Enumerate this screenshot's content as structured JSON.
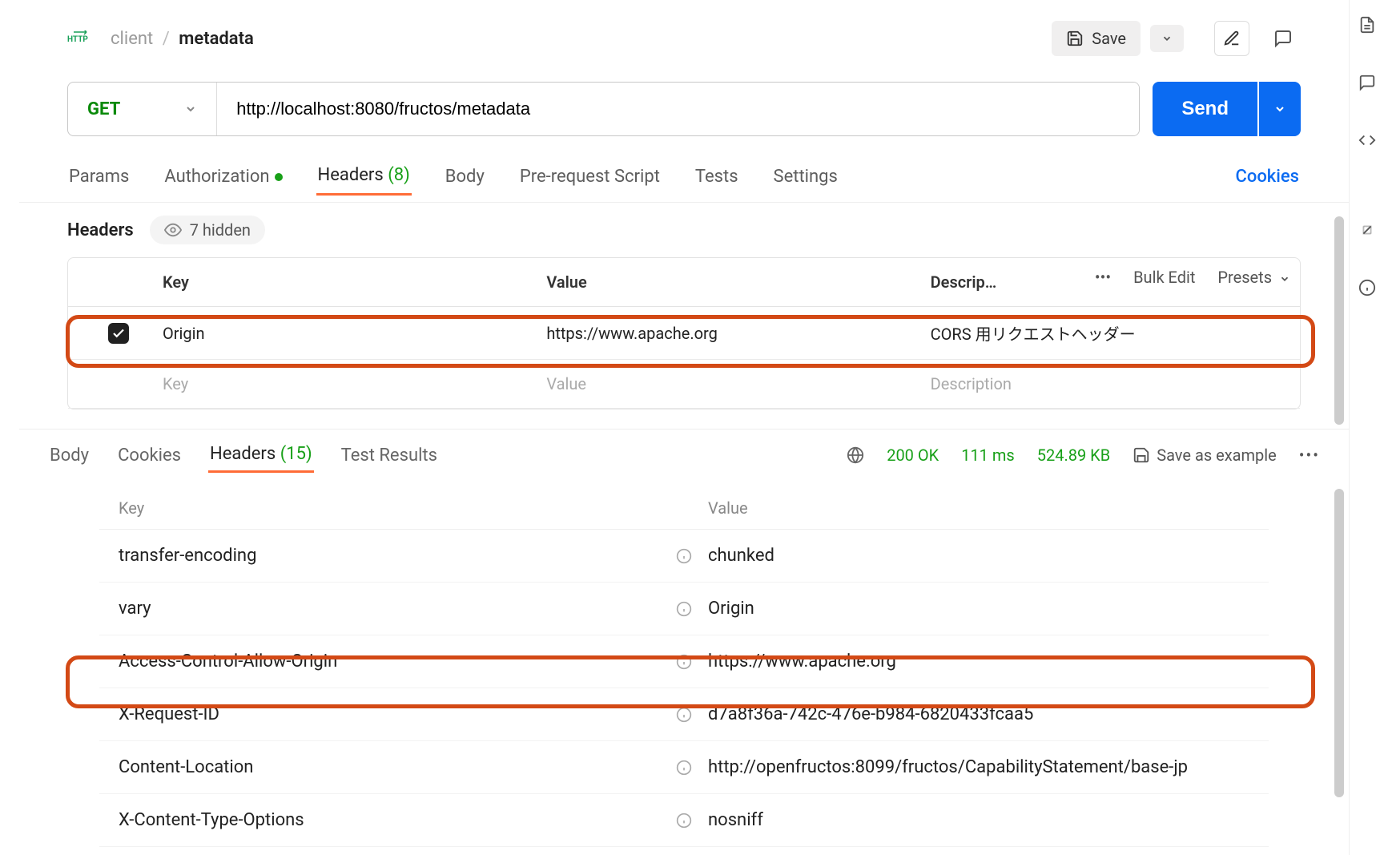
{
  "breadcrumb": {
    "parent": "client",
    "current": "metadata"
  },
  "toolbar": {
    "save": "Save"
  },
  "request": {
    "method": "GET",
    "url": "http://localhost:8080/fructos/metadata",
    "send": "Send"
  },
  "req_tabs": {
    "params": "Params",
    "auth": "Authorization",
    "headers": "Headers",
    "headers_count": "(8)",
    "body": "Body",
    "prereq": "Pre-request Script",
    "tests": "Tests",
    "settings": "Settings",
    "cookies": "Cookies"
  },
  "headers_section": {
    "title": "Headers",
    "hidden": "7 hidden",
    "columns": {
      "key": "Key",
      "value": "Value",
      "desc": "Descrip…"
    },
    "tools": {
      "bulk": "Bulk Edit",
      "presets": "Presets"
    },
    "rows": [
      {
        "checked": true,
        "key": "Origin",
        "value": "https://www.apache.org",
        "desc": "CORS 用リクエストヘッダー"
      }
    ],
    "placeholders": {
      "key": "Key",
      "value": "Value",
      "desc": "Description"
    }
  },
  "resp_tabs": {
    "body": "Body",
    "cookies": "Cookies",
    "headers": "Headers",
    "headers_count": "(15)",
    "test_results": "Test Results"
  },
  "resp_status": {
    "status": "200 OK",
    "time": "111 ms",
    "size": "524.89 KB",
    "save_example": "Save as example"
  },
  "resp_headers": {
    "columns": {
      "key": "Key",
      "value": "Value"
    },
    "rows": [
      {
        "key": "transfer-encoding",
        "value": "chunked"
      },
      {
        "key": "vary",
        "value": "Origin"
      },
      {
        "key": "Access-Control-Allow-Origin",
        "value": "https://www.apache.org",
        "highlight": true
      },
      {
        "key": "X-Request-ID",
        "value": "d7a8f36a-742c-476e-b984-6820433fcaa5"
      },
      {
        "key": "Content-Location",
        "value": "http://openfructos:8099/fructos/CapabilityStatement/base-jp"
      },
      {
        "key": "X-Content-Type-Options",
        "value": "nosniff"
      }
    ]
  }
}
